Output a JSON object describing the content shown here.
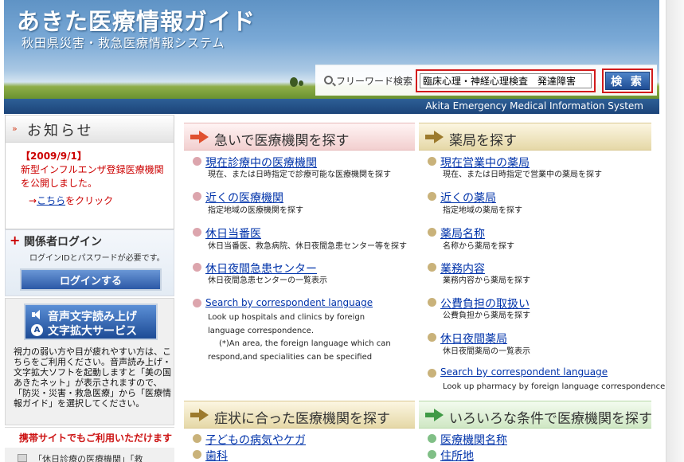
{
  "header": {
    "logo_main": "あきた医療情報ガイド",
    "logo_sub": "秋田県災害・救急医療情報システム",
    "search_label": "フリーワード検索",
    "search_value": "臨床心理・神経心理検査　発達障害",
    "search_button": "検 索",
    "strip_text": "Akita Emergency Medical Information System"
  },
  "sidebar": {
    "news": {
      "title": "お知らせ",
      "date": "【2009/9/1】",
      "body": "新型インフルエンザ登録医療機関を公開しました。",
      "arrow": "→",
      "link": "こちら",
      "link_suffix": "をクリック"
    },
    "login": {
      "title": "関係者ログイン",
      "note": "ログインIDとパスワードが必要です。",
      "button": "ログインする"
    },
    "access": {
      "line1": "音声文字読み上げ",
      "line2": "文字拡大サービス",
      "icon_letter": "A",
      "text": "視力の弱い方や目が疲れやすい方は、こちらをご利用ください。音声読み上げ・文字拡大ソフトを起動しますと「美の国あきたネット」が表示されますので、「防災・災害・救急医療」から「医療情報ガイド」を選択してください。"
    },
    "mobile": "携帯サイトでもご利用いただけます",
    "bottom_text": "「休日診療の医療機関」「救"
  },
  "main": {
    "urgent": {
      "title": "急いで医療機関を探す",
      "items": [
        {
          "link": "現在診療中の医療機関",
          "desc": "現在、または日時指定で診療可能な医療機関を探す"
        },
        {
          "link": "近くの医療機関",
          "desc": "指定地域の医療機関を探す"
        },
        {
          "link": "休日当番医",
          "desc": "休日当番医、救急病院、休日夜間急患センター等を探す"
        },
        {
          "link": "休日夜間急患センター",
          "desc": "休日夜間急患センターの一覧表示"
        },
        {
          "link": "Search by correspondent language",
          "desc": "Look up hospitals and clinics by foreign language correspondence.",
          "note": "(*)An area, the foreign language which can respond,and specialities can be specified"
        }
      ]
    },
    "pharmacy": {
      "title": "薬局を探す",
      "items": [
        {
          "link": "現在営業中の薬局",
          "desc": "現在、または日時指定で営業中の薬局を探す"
        },
        {
          "link": "近くの薬局",
          "desc": "指定地域の薬局を探す"
        },
        {
          "link": "薬局名称",
          "desc": "名称から薬局を探す"
        },
        {
          "link": "業務内容",
          "desc": "業務内容から薬局を探す"
        },
        {
          "link": "公費負担の取扱い",
          "desc": "公費負担から薬局を探す"
        },
        {
          "link": "休日夜間薬局",
          "desc": "休日夜間薬局の一覧表示"
        },
        {
          "link": "Search by correspondent language",
          "desc": "Look up pharmacy by foreign language correspondence."
        }
      ]
    },
    "symptom": {
      "title": "症状に合った医療機関を探す",
      "items": [
        {
          "link": "子どもの病気やケガ"
        },
        {
          "link": "歯科"
        }
      ]
    },
    "conditions": {
      "title": "いろいろな条件で医療機関を探す",
      "items": [
        {
          "link": "医療機関名称"
        },
        {
          "link": "住所地"
        }
      ]
    }
  }
}
